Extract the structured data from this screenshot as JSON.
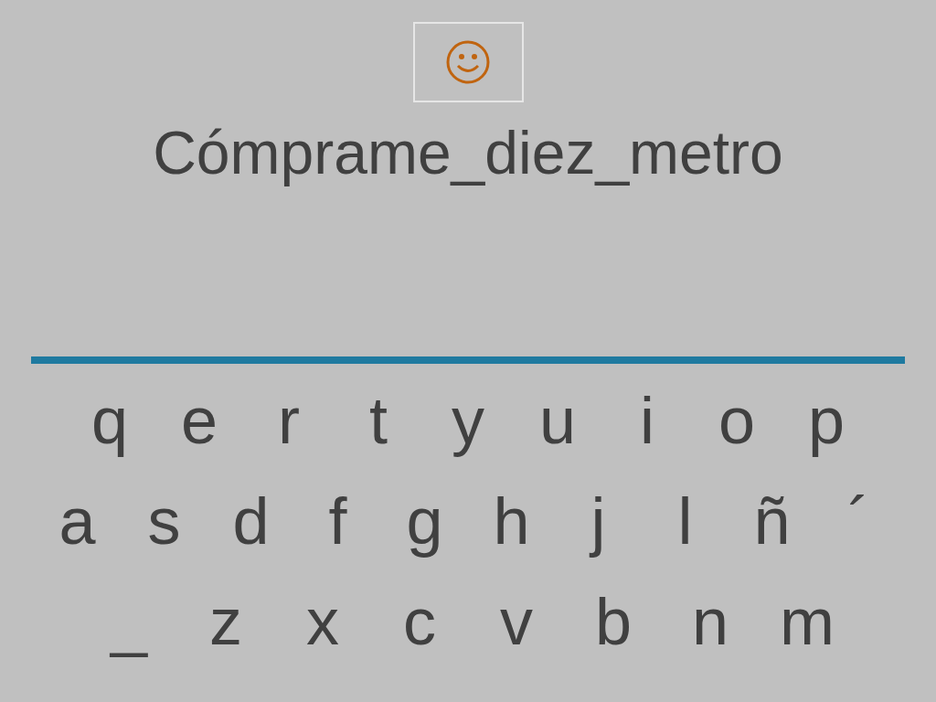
{
  "phrase": "Cómprame_diez_metro",
  "keyboard": {
    "rows": [
      {
        "keys": [
          "q",
          "e",
          "r",
          "t",
          "y",
          "u",
          "i",
          "o",
          "p"
        ]
      },
      {
        "keys": [
          "a",
          "s",
          "d",
          "f",
          "g",
          "h",
          "j",
          "l",
          "ñ",
          "´"
        ]
      },
      {
        "keys": [
          "_",
          "z",
          "x",
          "c",
          "v",
          "b",
          "n",
          "m"
        ]
      }
    ]
  }
}
